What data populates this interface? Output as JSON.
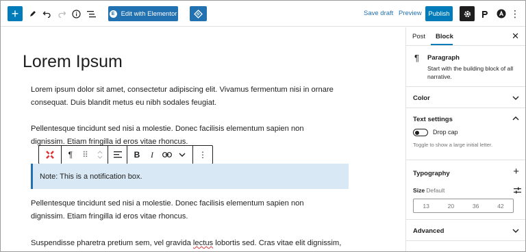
{
  "toolbar": {
    "edit_elementor_label": "Edit with Elementor",
    "save_draft_label": "Save draft",
    "preview_label": "Preview",
    "publish_label": "Publish",
    "icons": [
      "plus-icon",
      "pen-icon",
      "undo-icon",
      "redo-icon",
      "info-icon",
      "list-view-icon",
      "navigator-icon",
      "gear-icon",
      "plugin-p-icon",
      "plugin-a-icon",
      "more-vertical-icon"
    ]
  },
  "editor": {
    "title": "Lorem Ipsum",
    "paragraphs": [
      "Lorem ipsum dolor sit amet, consectetur adipiscing elit. Vivamus fermentum nisi in ornare consequat. Duis blandit metus eu nibh sodales feugiat.",
      "Pellentesque tincidunt sed nisi a molestie. Donec facilisis elementum sapien non dignissim. Etiam fringilla id eros vitae rhoncus.",
      "Pellentesque tincidunt sed nisi a molestie. Donec facilisis elementum sapien non dignissim. Etiam fringilla id eros vitae rhoncus."
    ],
    "last_para_start": "Suspendisse pharetra pretium sem, vel gravida ",
    "last_para_squiggle": "lectus",
    "last_para_end": " lobortis sed. Cras vitae elit dignissim,",
    "notification": "Note: This is a notification box."
  },
  "block_toolbar": {
    "pilcrow": "¶",
    "drag": "⠿",
    "bold": "B",
    "italic": "I",
    "more": "⋮"
  },
  "sidebar": {
    "tab_post": "Post",
    "tab_block": "Block",
    "close": "✕",
    "block_name": "Paragraph",
    "block_desc": "Start with the building block of all narrative.",
    "panels": {
      "color": "Color",
      "text_settings": "Text settings",
      "typography": "Typography",
      "advanced": "Advanced"
    },
    "drop_cap_label": "Drop cap",
    "drop_cap_help": "Toggle to show a large initial letter.",
    "size_label": "Size",
    "size_default": "Default",
    "sizes": [
      "13",
      "20",
      "36",
      "42"
    ]
  },
  "colors": {
    "accent": "#007cba",
    "notification_bg": "#d8e8f4",
    "elementor_blue": "#2271b1"
  }
}
